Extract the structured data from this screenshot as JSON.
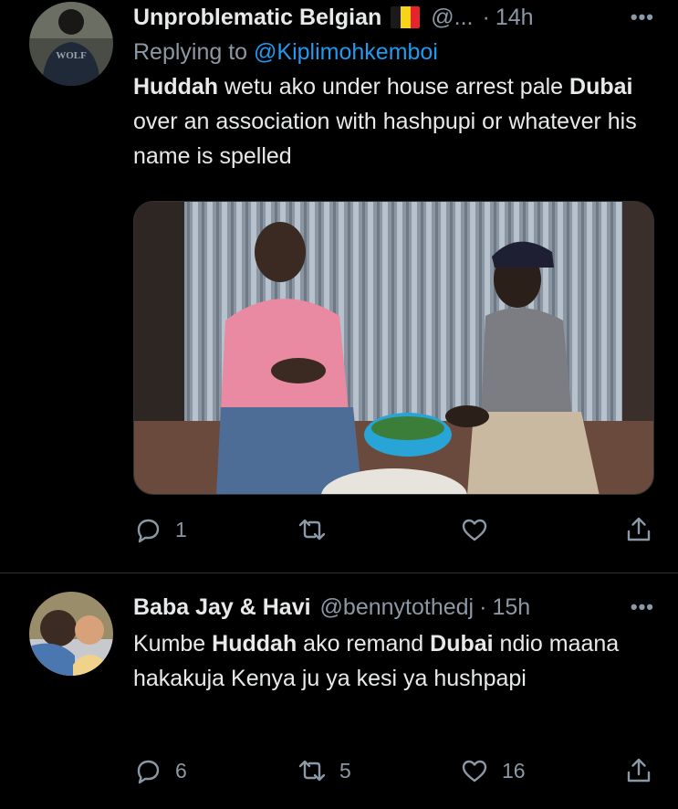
{
  "tweets": [
    {
      "author_name": "Unproblematic Belgian",
      "handle": "@...",
      "dot": "·",
      "time": "14h",
      "more": "•••",
      "replying_prefix": "Replying to ",
      "replying_handle": "@Kiplimohkemboi",
      "text_parts": [
        {
          "t": "Huddah",
          "bold": true
        },
        {
          "t": " wetu ako under house arrest pale ",
          "bold": false
        },
        {
          "t": "Dubai",
          "bold": true
        },
        {
          "t": " over an association with hashpupi or whatever his name is spelled",
          "bold": false
        }
      ],
      "avatar_text": "WOLF",
      "reply_count": "1",
      "retweet_count": "",
      "like_count": ""
    },
    {
      "author_name": "Baba Jay & Havi",
      "handle": "@bennytothedj",
      "dot": "·",
      "time": "15h",
      "more": "•••",
      "text_parts": [
        {
          "t": "Kumbe ",
          "bold": false
        },
        {
          "t": "Huddah",
          "bold": true
        },
        {
          "t": " ako remand ",
          "bold": false
        },
        {
          "t": "Dubai",
          "bold": true
        },
        {
          "t": " ndio maana hakakuja Kenya ju  ya kesi ya hushpapi",
          "bold": false
        }
      ],
      "reply_count": "6",
      "retweet_count": "5",
      "like_count": "16"
    }
  ],
  "colors": {
    "background": "#000000",
    "primary_text": "#e7e9ea",
    "secondary_text": "#8b98a5",
    "link": "#1d9bf0",
    "divider": "#2f3336"
  },
  "icons": [
    "reply-icon",
    "retweet-icon",
    "like-icon",
    "share-icon",
    "more-icon",
    "belgium-flag-icon"
  ]
}
